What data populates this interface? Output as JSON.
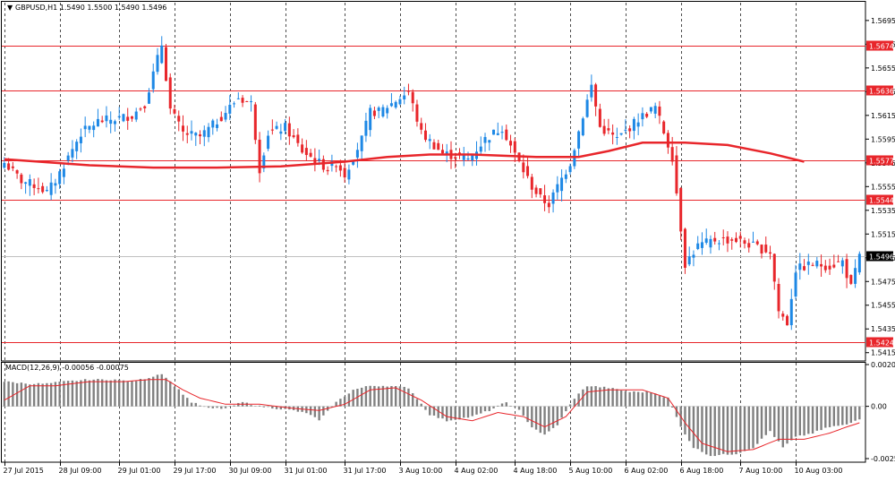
{
  "chart_data": [
    {
      "type": "candlestick",
      "symbol": "GBPUSD,H1",
      "title": "GBPUSD,H1  1.5490 1.5500 1.5490 1.5496",
      "ohlc_header": {
        "open": 1.549,
        "high": 1.55,
        "low": 1.549,
        "close": 1.5496
      },
      "ylim": [
        1.5408,
        1.571
      ],
      "y_ticks": [
        1.5415,
        1.5435,
        1.5455,
        1.5475,
        1.5495,
        1.5515,
        1.5535,
        1.5555,
        1.5575,
        1.5595,
        1.5615,
        1.5635,
        1.5655,
        1.5675,
        1.5695
      ],
      "x_labels": [
        "27 Jul 2015",
        "28 Jul 09:00",
        "29 Jul 01:00",
        "29 Jul 17:00",
        "30 Jul 09:00",
        "31 Jul 01:00",
        "31 Jul 17:00",
        "3 Aug 10:00",
        "4 Aug 02:00",
        "4 Aug 18:00",
        "5 Aug 10:00",
        "6 Aug 02:00",
        "6 Aug 18:00",
        "7 Aug 10:00",
        "10 Aug 03:00"
      ],
      "horizontal_levels": [
        {
          "value": 1.5674,
          "label": "1.5674",
          "color": "#e8262b"
        },
        {
          "value": 1.5636,
          "label": "1.5636",
          "color": "#e8262b"
        },
        {
          "value": 1.5577,
          "label": "1.5577",
          "color": "#e8262b"
        },
        {
          "value": 1.5544,
          "label": "1.5544",
          "color": "#e8262b"
        },
        {
          "value": 1.5424,
          "label": "1.5424",
          "color": "#e8262b"
        }
      ],
      "current_price": {
        "value": 1.5496,
        "label": "1.5496"
      },
      "moving_average": {
        "color": "#e8262b",
        "points": [
          [
            0,
            1.5578
          ],
          [
            20,
            1.5573
          ],
          [
            35,
            1.5571
          ],
          [
            50,
            1.5571
          ],
          [
            65,
            1.5572
          ],
          [
            80,
            1.5576
          ],
          [
            90,
            1.558
          ],
          [
            100,
            1.5582
          ],
          [
            110,
            1.5582
          ],
          [
            125,
            1.558
          ],
          [
            135,
            1.558
          ],
          [
            142,
            1.5585
          ],
          [
            150,
            1.5592
          ],
          [
            160,
            1.5592
          ],
          [
            170,
            1.559
          ],
          [
            180,
            1.5583
          ],
          [
            188,
            1.5576
          ]
        ]
      },
      "anchors": [
        [
          0,
          1.5575
        ],
        [
          4,
          1.556
        ],
        [
          8,
          1.5555
        ],
        [
          10,
          1.555
        ],
        [
          12,
          1.556
        ],
        [
          15,
          1.558
        ],
        [
          18,
          1.56
        ],
        [
          22,
          1.561
        ],
        [
          26,
          1.5612
        ],
        [
          30,
          1.5615
        ],
        [
          33,
          1.5625
        ],
        [
          35,
          1.565
        ],
        [
          37,
          1.5675
        ],
        [
          39,
          1.562
        ],
        [
          42,
          1.56
        ],
        [
          46,
          1.5597
        ],
        [
          50,
          1.561
        ],
        [
          55,
          1.563
        ],
        [
          58,
          1.5625
        ],
        [
          60,
          1.557
        ],
        [
          62,
          1.56
        ],
        [
          66,
          1.5605
        ],
        [
          70,
          1.5585
        ],
        [
          74,
          1.5575
        ],
        [
          76,
          1.557
        ],
        [
          78,
          1.5575
        ],
        [
          80,
          1.5565
        ],
        [
          84,
          1.5595
        ],
        [
          86,
          1.5618
        ],
        [
          88,
          1.5618
        ],
        [
          91,
          1.5625
        ],
        [
          95,
          1.5635
        ],
        [
          98,
          1.56
        ],
        [
          103,
          1.5583
        ],
        [
          107,
          1.558
        ],
        [
          109,
          1.5578
        ],
        [
          113,
          1.5595
        ],
        [
          117,
          1.5605
        ],
        [
          120,
          1.5582
        ],
        [
          124,
          1.5555
        ],
        [
          126,
          1.5545
        ],
        [
          128,
          1.554
        ],
        [
          130,
          1.5555
        ],
        [
          133,
          1.5575
        ],
        [
          136,
          1.5615
        ],
        [
          138,
          1.564
        ],
        [
          140,
          1.5605
        ],
        [
          144,
          1.5595
        ],
        [
          149,
          1.5612
        ],
        [
          153,
          1.5622
        ],
        [
          157,
          1.558
        ],
        [
          160,
          1.549
        ],
        [
          163,
          1.5505
        ],
        [
          167,
          1.551
        ],
        [
          172,
          1.551
        ],
        [
          176,
          1.5505
        ],
        [
          180,
          1.55
        ],
        [
          182,
          1.545
        ],
        [
          184,
          1.544
        ],
        [
          186,
          1.5485
        ],
        [
          190,
          1.549
        ],
        [
          194,
          1.5488
        ],
        [
          197,
          1.5492
        ],
        [
          199,
          1.547
        ],
        [
          201,
          1.5496
        ]
      ],
      "series": [
        {
          "name": "GBPUSD,H1",
          "n_bars": 202,
          "up_color": "#1e88e5",
          "down_color": "#e8262b"
        }
      ]
    },
    {
      "type": "histogram",
      "title": "MACD(12,26,9) -0.00056 -0.00075",
      "indicator": "MACD(12,26,9)",
      "last_values": {
        "macd": -0.00056,
        "signal": -0.00075
      },
      "ylim": [
        -0.00254,
        0.00203
      ],
      "y_ticks": [
        {
          "value": 0.00203,
          "label": "0.00203"
        },
        {
          "value": 0.0,
          "label": "0.00"
        },
        {
          "value": -0.00254,
          "label": "-0.00254"
        }
      ],
      "series": [
        {
          "name": "MACD",
          "color": "#808080",
          "anchors": [
            [
              0,
              0.0012
            ],
            [
              6,
              0.0011
            ],
            [
              10,
              0.0011
            ],
            [
              14,
              0.0012
            ],
            [
              20,
              0.0013
            ],
            [
              26,
              0.0013
            ],
            [
              30,
              0.0012
            ],
            [
              34,
              0.0014
            ],
            [
              37,
              0.0016
            ],
            [
              40,
              0.001
            ],
            [
              44,
              0.0002
            ],
            [
              48,
              -0.0001
            ],
            [
              52,
              -0.0001
            ],
            [
              56,
              0.0002
            ],
            [
              60,
              0.0
            ],
            [
              64,
              -0.0001
            ],
            [
              68,
              -0.0002
            ],
            [
              72,
              -0.0004
            ],
            [
              74,
              -0.0007
            ],
            [
              78,
              0.0002
            ],
            [
              82,
              0.0008
            ],
            [
              86,
              0.001
            ],
            [
              90,
              0.001
            ],
            [
              95,
              0.0009
            ],
            [
              100,
              -0.0004
            ],
            [
              104,
              -0.0007
            ],
            [
              110,
              -0.0005
            ],
            [
              114,
              -0.0002
            ],
            [
              118,
              0.0002
            ],
            [
              121,
              -0.0002
            ],
            [
              124,
              -0.001
            ],
            [
              127,
              -0.0014
            ],
            [
              130,
              -0.0009
            ],
            [
              134,
              0.0004
            ],
            [
              137,
              0.001
            ],
            [
              142,
              0.0009
            ],
            [
              147,
              0.0007
            ],
            [
              152,
              0.0007
            ],
            [
              156,
              0.0004
            ],
            [
              159,
              -0.001
            ],
            [
              162,
              -0.002
            ],
            [
              166,
              -0.0024
            ],
            [
              172,
              -0.0023
            ],
            [
              176,
              -0.002
            ],
            [
              180,
              -0.0012
            ],
            [
              183,
              -0.002
            ],
            [
              186,
              -0.0015
            ],
            [
              190,
              -0.0013
            ],
            [
              194,
              -0.001
            ],
            [
              198,
              -0.0009
            ],
            [
              201,
              -0.0006
            ]
          ]
        },
        {
          "name": "Signal",
          "color": "#e8262b",
          "anchors": [
            [
              0,
              0.0003
            ],
            [
              6,
              0.001
            ],
            [
              12,
              0.001
            ],
            [
              20,
              0.0012
            ],
            [
              28,
              0.0012
            ],
            [
              34,
              0.0013
            ],
            [
              38,
              0.0013
            ],
            [
              42,
              0.0008
            ],
            [
              46,
              0.0004
            ],
            [
              52,
              0.0001
            ],
            [
              60,
              0.0001
            ],
            [
              68,
              -0.0001
            ],
            [
              74,
              -0.0002
            ],
            [
              80,
              0.0001
            ],
            [
              86,
              0.0008
            ],
            [
              92,
              0.0009
            ],
            [
              98,
              0.0003
            ],
            [
              104,
              -0.0005
            ],
            [
              110,
              -0.0007
            ],
            [
              116,
              -0.0003
            ],
            [
              122,
              -0.0005
            ],
            [
              127,
              -0.001
            ],
            [
              132,
              -0.0005
            ],
            [
              137,
              0.0007
            ],
            [
              142,
              0.0008
            ],
            [
              150,
              0.0008
            ],
            [
              156,
              0.0004
            ],
            [
              160,
              -0.0008
            ],
            [
              164,
              -0.0018
            ],
            [
              170,
              -0.0022
            ],
            [
              176,
              -0.0021
            ],
            [
              182,
              -0.0016
            ],
            [
              188,
              -0.0016
            ],
            [
              194,
              -0.0013
            ],
            [
              198,
              -0.001
            ],
            [
              201,
              -0.0008
            ]
          ]
        }
      ]
    }
  ]
}
